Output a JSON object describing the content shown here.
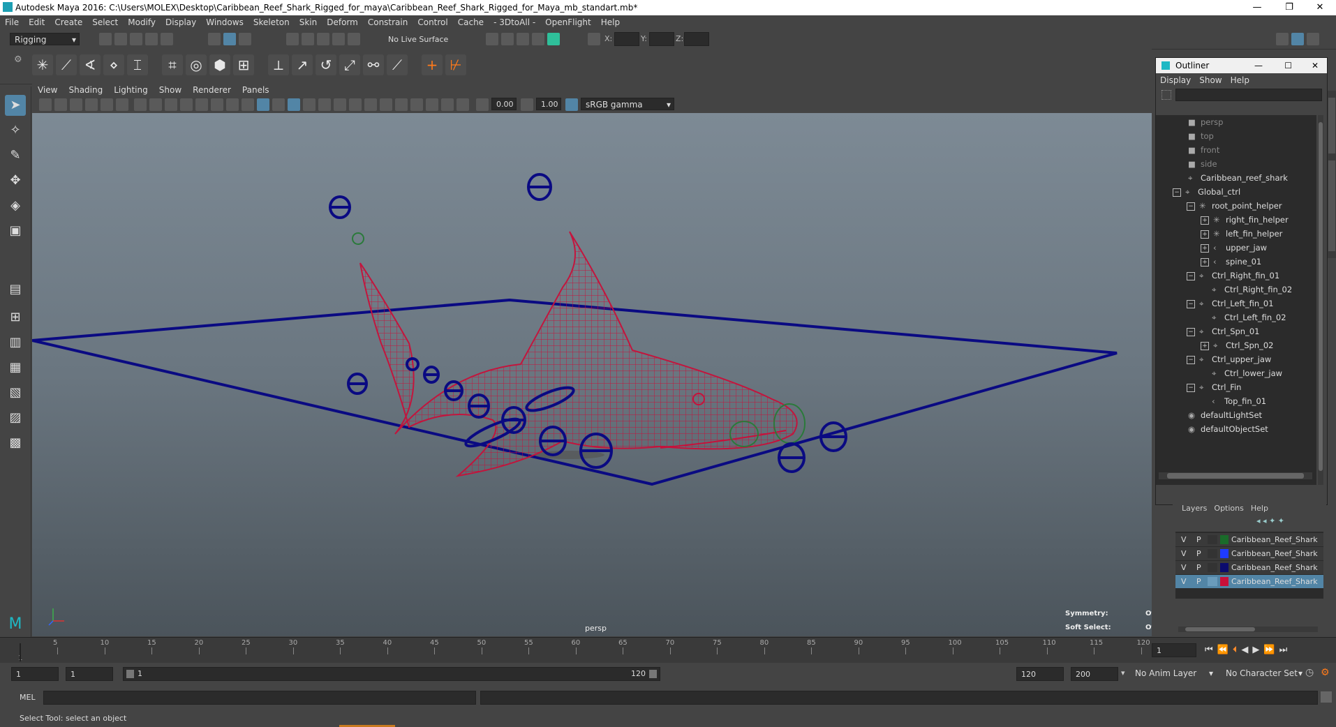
{
  "window": {
    "title": "Autodesk Maya 2016: C:\\Users\\MOLEX\\Desktop\\Caribbean_Reef_Shark_Rigged_for_maya\\Caribbean_Reef_Shark_Rigged_for_Maya_mb_standart.mb*",
    "minimize": "—",
    "maximize": "❐",
    "close": "✕"
  },
  "menubar": [
    "File",
    "Edit",
    "Create",
    "Select",
    "Modify",
    "Display",
    "Windows",
    "Skeleton",
    "Skin",
    "Deform",
    "Constrain",
    "Control",
    "Cache",
    "- 3DtoAll -",
    "OpenFlight",
    "Help"
  ],
  "statusline": {
    "mode": "Rigging",
    "live_surface": "No Live Surface",
    "x_label": "X:",
    "y_label": "Y:",
    "z_label": "Z:"
  },
  "viewport": {
    "menus": [
      "View",
      "Shading",
      "Lighting",
      "Show",
      "Renderer",
      "Panels"
    ],
    "near_value": "0.00",
    "far_value": "1.00",
    "color_space": "sRGB gamma",
    "camera_label": "persp",
    "symmetry_label": "Symmetry:",
    "symmetry_value": "Off",
    "soft_select_label": "Soft Select:",
    "soft_select_value": "Off"
  },
  "outliner": {
    "title": "Outliner",
    "menus": [
      "Display",
      "Show",
      "Help"
    ],
    "items": [
      {
        "label": "persp",
        "icon": "camera-icon",
        "dim": true
      },
      {
        "label": "top",
        "icon": "camera-icon",
        "dim": true
      },
      {
        "label": "front",
        "icon": "camera-icon",
        "dim": true
      },
      {
        "label": "side",
        "icon": "camera-icon",
        "dim": true
      },
      {
        "label": "Caribbean_reef_shark",
        "icon": "mesh-icon",
        "dim": false
      },
      {
        "label": "Global_ctrl",
        "icon": "curve-icon",
        "dim": false
      },
      {
        "label": "root_point_helper",
        "icon": "locator-icon",
        "dim": false
      },
      {
        "label": "right_fin_helper",
        "icon": "locator-icon",
        "dim": false
      },
      {
        "label": "left_fin_helper",
        "icon": "locator-icon",
        "dim": false
      },
      {
        "label": "upper_jaw",
        "icon": "joint-icon",
        "dim": false
      },
      {
        "label": "spine_01",
        "icon": "joint-icon",
        "dim": false
      },
      {
        "label": "Ctrl_Right_fin_01",
        "icon": "curve-icon",
        "dim": false
      },
      {
        "label": "Ctrl_Right_fin_02",
        "icon": "curve-icon",
        "dim": false
      },
      {
        "label": "Ctrl_Left_fin_01",
        "icon": "curve-icon",
        "dim": false
      },
      {
        "label": "Ctrl_Left_fin_02",
        "icon": "curve-icon",
        "dim": false
      },
      {
        "label": "Ctrl_Spn_01",
        "icon": "curve-icon",
        "dim": false
      },
      {
        "label": "Ctrl_Spn_02",
        "icon": "curve-icon",
        "dim": false
      },
      {
        "label": "Ctrl_upper_jaw",
        "icon": "curve-icon",
        "dim": false
      },
      {
        "label": "Ctrl_lower_jaw",
        "icon": "curve-icon",
        "dim": false
      },
      {
        "label": "Ctrl_Fin",
        "icon": "curve-icon",
        "dim": false
      },
      {
        "label": "Top_fin_01",
        "icon": "joint-icon",
        "dim": false
      },
      {
        "label": "defaultLightSet",
        "icon": "set-icon",
        "dim": false
      },
      {
        "label": "defaultObjectSet",
        "icon": "set-icon",
        "dim": false
      }
    ]
  },
  "layers": {
    "menus": [
      "Layers",
      "Options",
      "Help"
    ],
    "rows": [
      {
        "v": "V",
        "p": "P",
        "name": "Caribbean_Reef_Shark",
        "color": "#1a6b2a"
      },
      {
        "v": "V",
        "p": "P",
        "name": "Caribbean_Reef_Shark",
        "color": "#1f3bff"
      },
      {
        "v": "V",
        "p": "P",
        "name": "Caribbean_Reef_Shark",
        "color": "#0b0b6e"
      },
      {
        "v": "V",
        "p": "P",
        "name": "Caribbean_Reef_Shark",
        "color": "#c8103a"
      }
    ]
  },
  "timeline": {
    "labels": [
      "5",
      "10",
      "15",
      "20",
      "25",
      "30",
      "35",
      "40",
      "45",
      "50",
      "55",
      "60",
      "65",
      "70",
      "75",
      "80",
      "85",
      "90",
      "95",
      "100",
      "105",
      "110",
      "115",
      "120"
    ],
    "first": "1",
    "current_frame": "1"
  },
  "range": {
    "start": "1",
    "playback_start": "1",
    "slider_start": "1",
    "slider_end": "120",
    "playback_end": "120",
    "end": "200",
    "anim_layer": "No Anim Layer",
    "character_set": "No Character Set"
  },
  "mel": {
    "label": "MEL"
  },
  "help": {
    "text": "Select Tool: select an object"
  }
}
